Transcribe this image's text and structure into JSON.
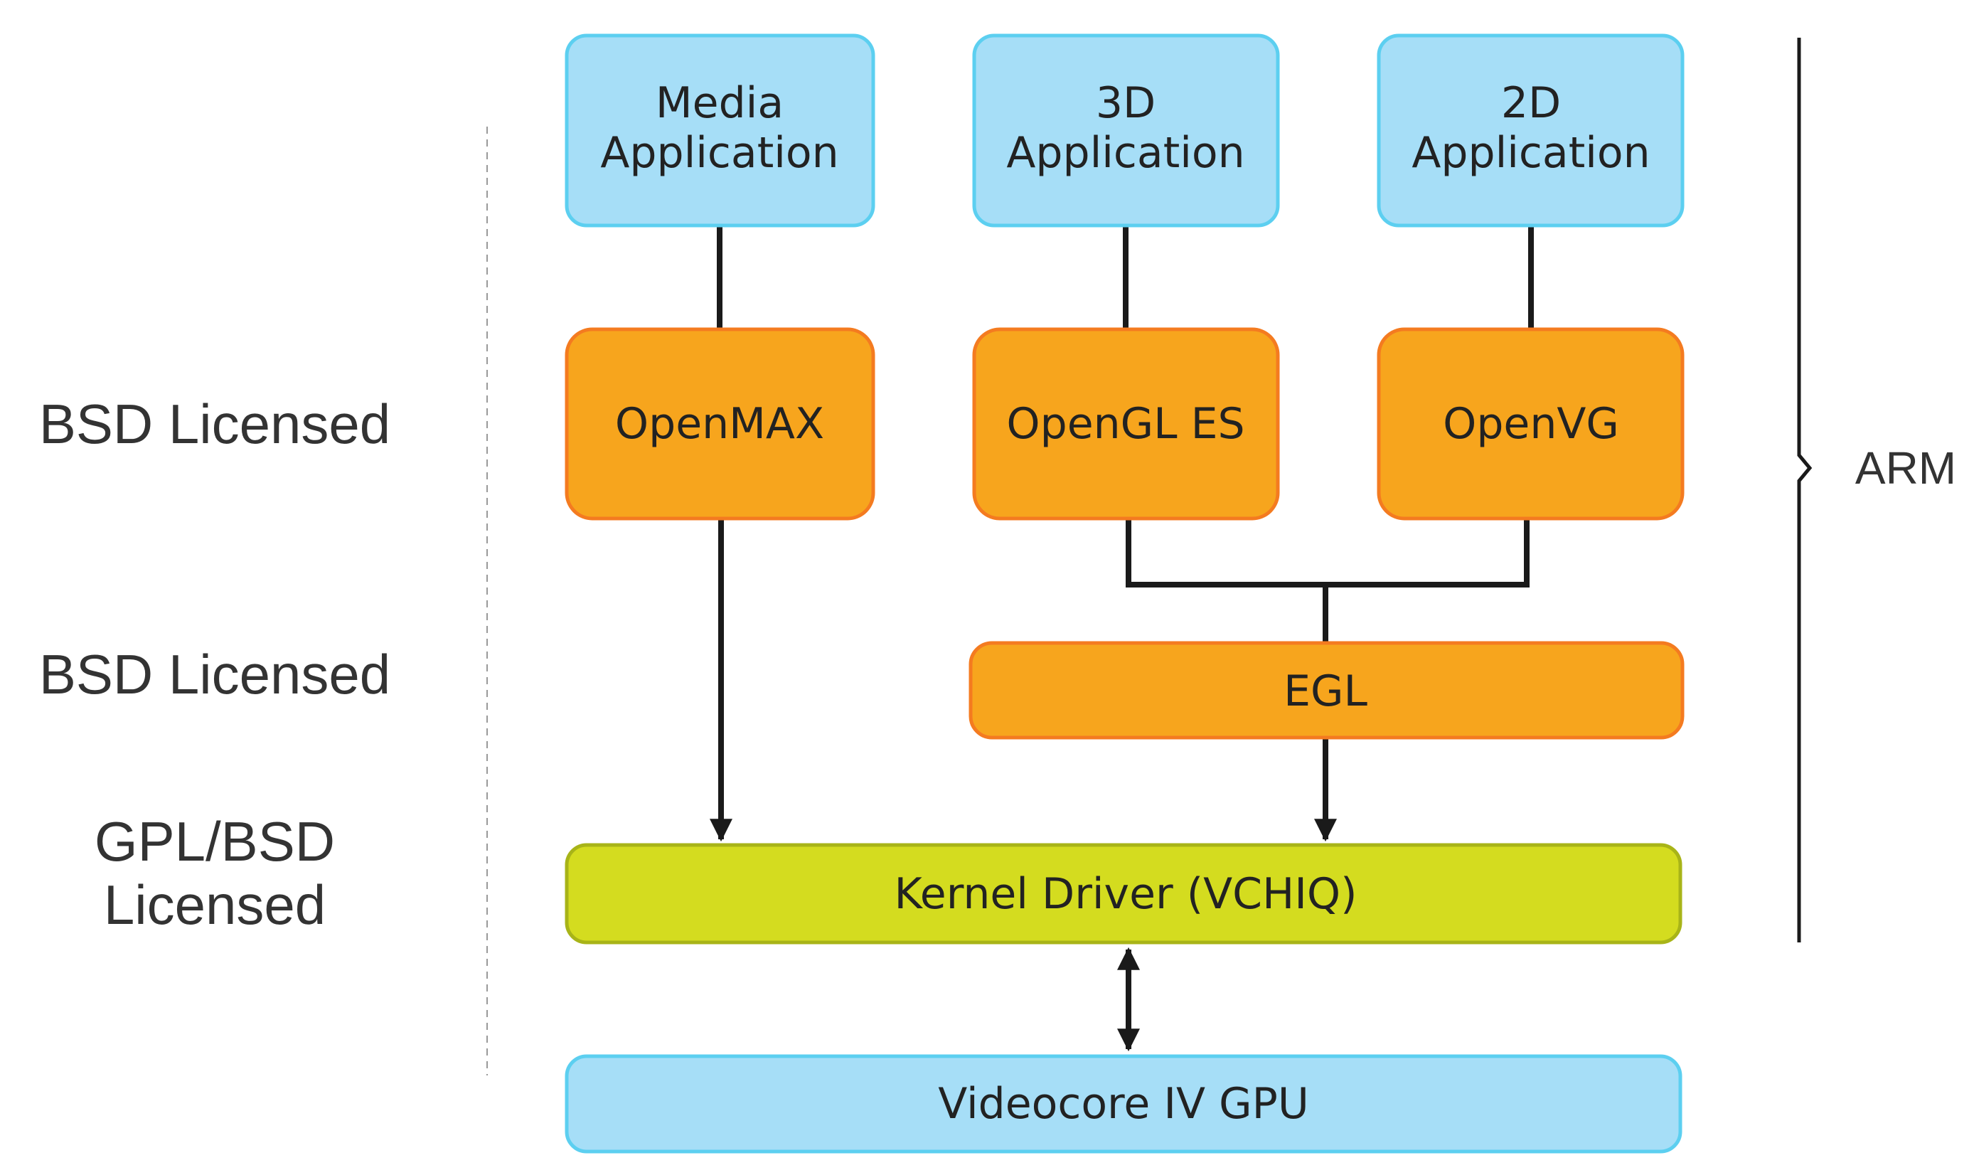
{
  "colors": {
    "application_fill": "#a6def7",
    "application_border": "#5ccff0",
    "api_fill": "#f7a51d",
    "api_border": "#f47b20",
    "driver_fill": "#d4dc1f",
    "driver_border": "#a8b418",
    "connector": "#1a1a1a"
  },
  "side_labels": {
    "api_layer": "BSD Licensed",
    "egl_layer": "BSD Licensed",
    "driver_layer_line1": "GPL/BSD",
    "driver_layer_line2": "Licensed"
  },
  "arm_label": "ARM",
  "nodes": {
    "media_app": {
      "line1": "Media",
      "line2": "Application"
    },
    "app_3d": {
      "line1": "3D",
      "line2": "Application"
    },
    "app_2d": {
      "line1": "2D",
      "line2": "Application"
    },
    "openmax": "OpenMAX",
    "opengl_es": "OpenGL ES",
    "openvg": "OpenVG",
    "egl": "EGL",
    "kernel_driver": "Kernel Driver (VCHIQ)",
    "gpu": "Videocore IV GPU"
  }
}
